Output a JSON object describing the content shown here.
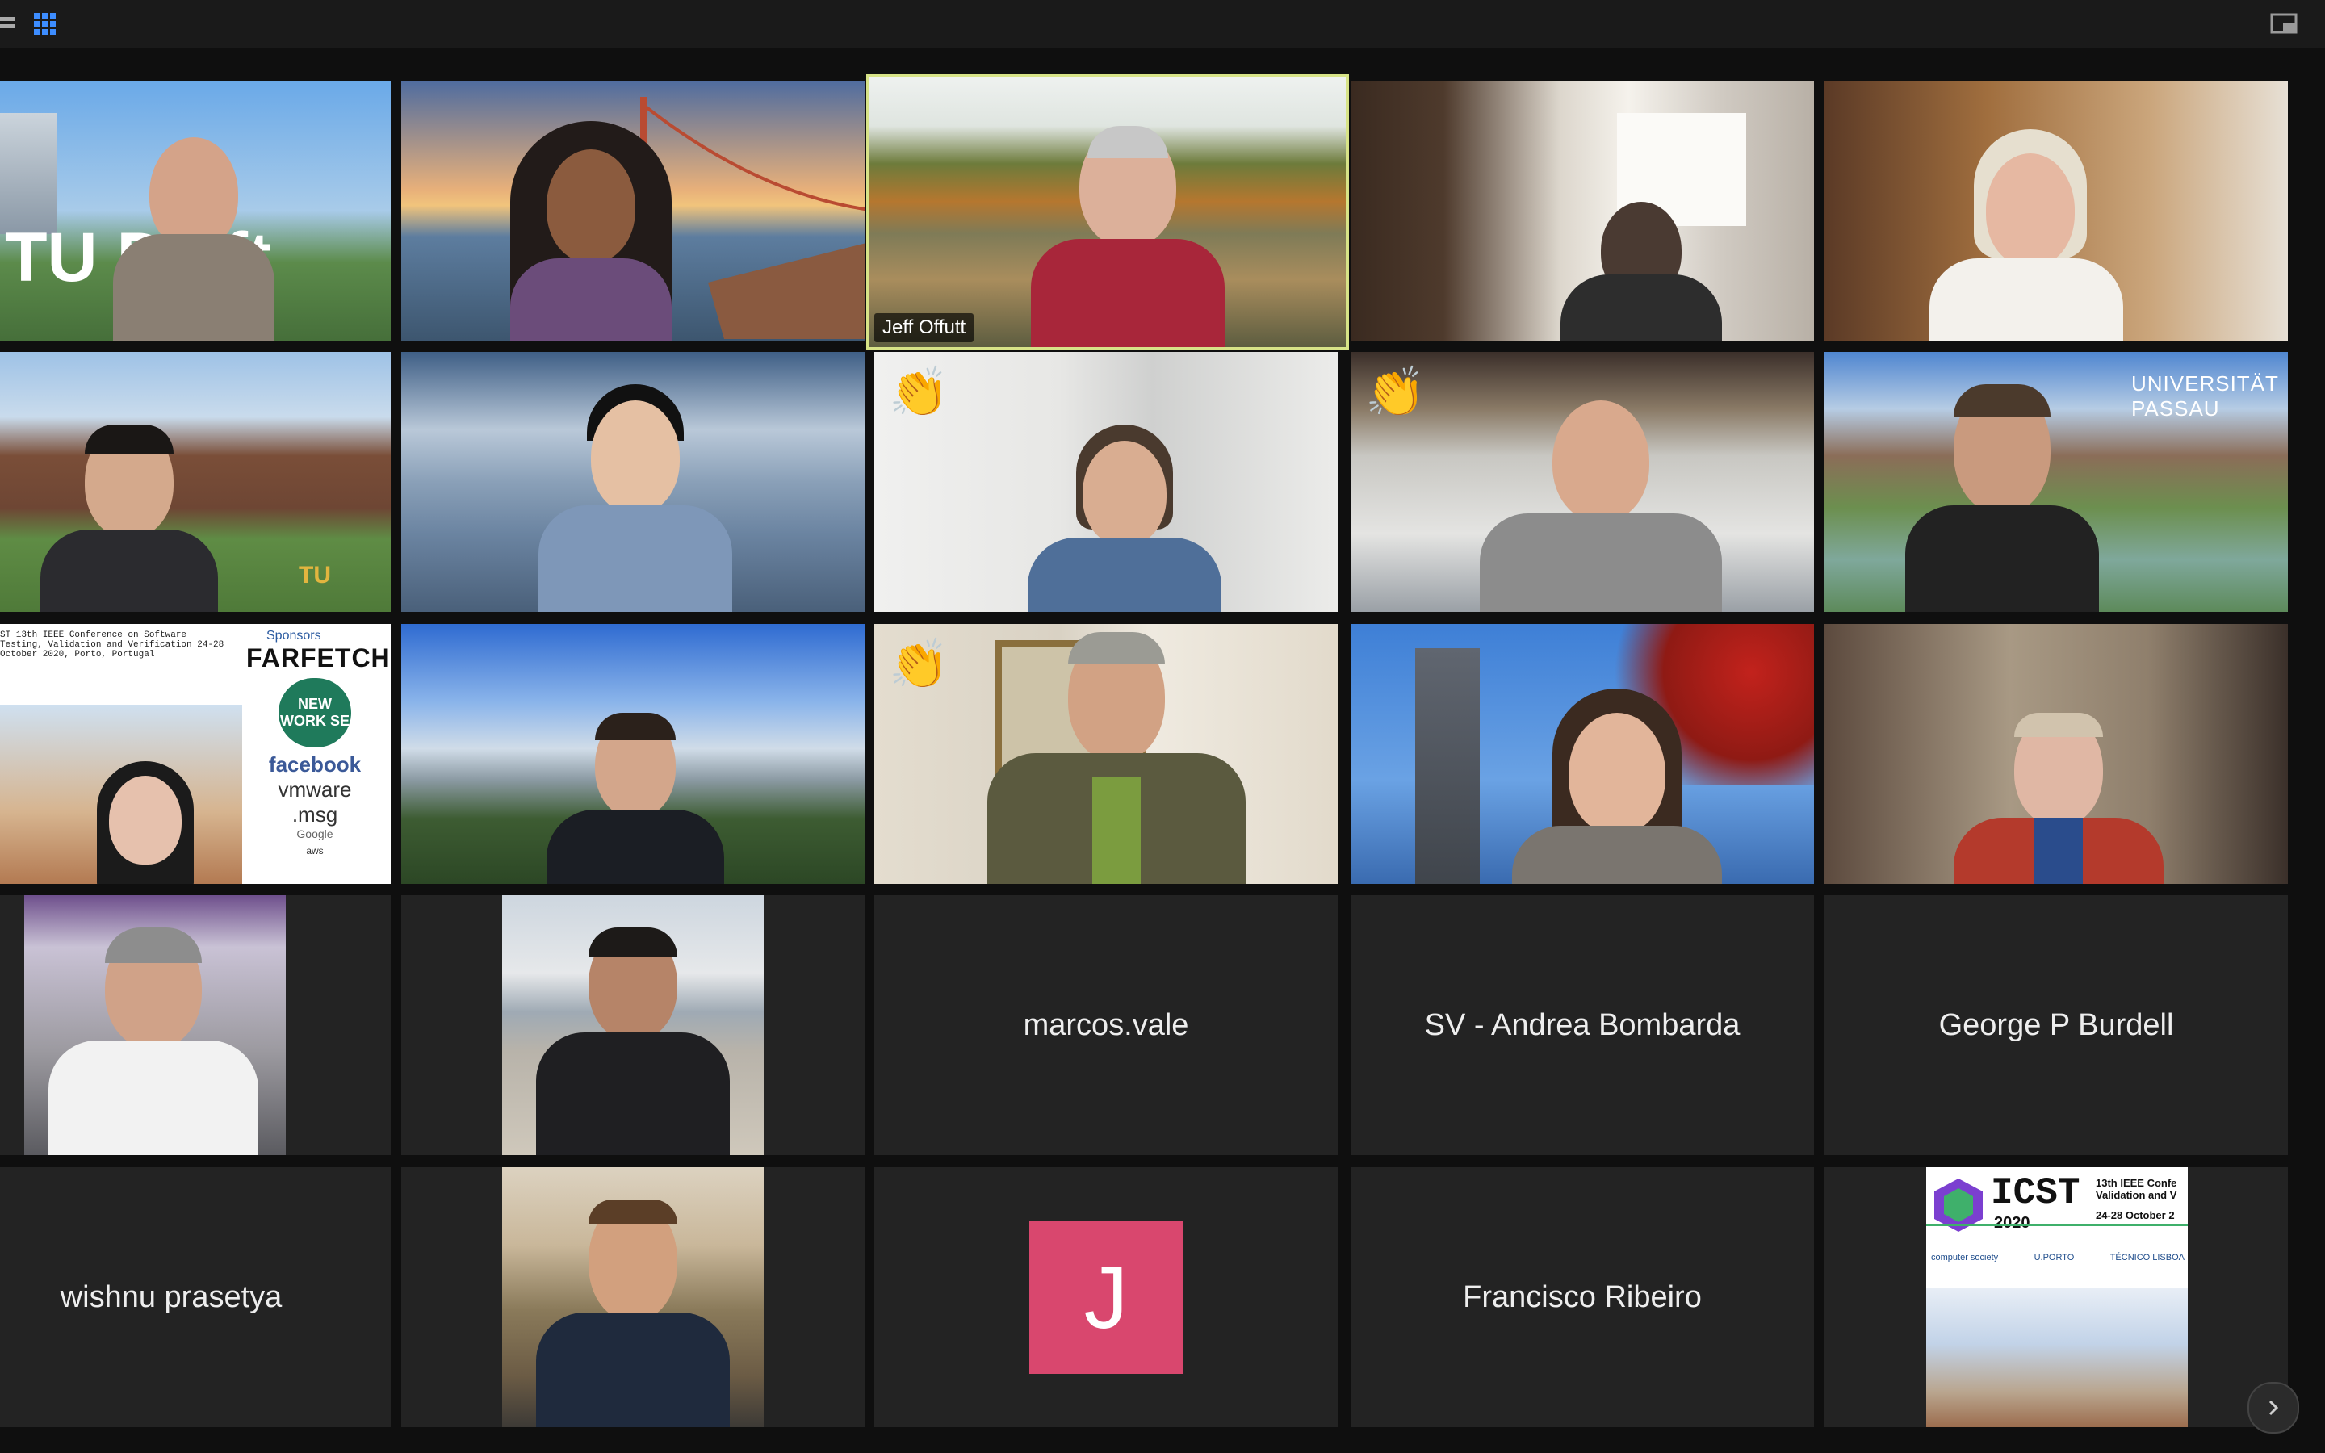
{
  "toolbar": {
    "left_icons": [
      "speaker-view-icon",
      "gallery-view-icon"
    ],
    "right_icon": "exit-fullscreen-icon"
  },
  "tiles": {
    "r1c3": {
      "name": "Jeff Offutt"
    },
    "r4c3": {
      "name": "marcos.vale"
    },
    "r4c4": {
      "name": "SV - Andrea Bombarda"
    },
    "r4c5": {
      "name": "George P Burdell"
    },
    "r5c1": {
      "name": "wishnu prasetya"
    },
    "r5c3": {
      "avatar_letter": "J"
    },
    "r5c4": {
      "name": "Francisco Ribeiro"
    }
  },
  "reactions": {
    "clap": "👏"
  },
  "backgrounds": {
    "r1c1": "TU Delft",
    "r2c1": "TU",
    "r2c5": "UNIVERSITÄT PASSAU"
  },
  "sponsor_slide": {
    "header": "ST 13th IEEE Conference on Software Testing, Validation and Verification 24-28 October 2020, Porto, Portugal",
    "title": "Sponsors",
    "logos": [
      "FARFETCH",
      "NEW WORK SE",
      "facebook",
      "vmware",
      ".msg",
      "Google",
      "aws"
    ]
  },
  "icst_slide": {
    "title": "ICST",
    "year": "2020",
    "subtitle": "13th IEEE Confe\nValidation and V",
    "dates": "24-28 October 2",
    "partners": [
      "computer society",
      "U.PORTO",
      "TÉCNICO LISBOA"
    ]
  },
  "colors": {
    "active_speaker": "#d7e387",
    "avatar_j": "#d9476e",
    "tile_bg": "#232323"
  }
}
